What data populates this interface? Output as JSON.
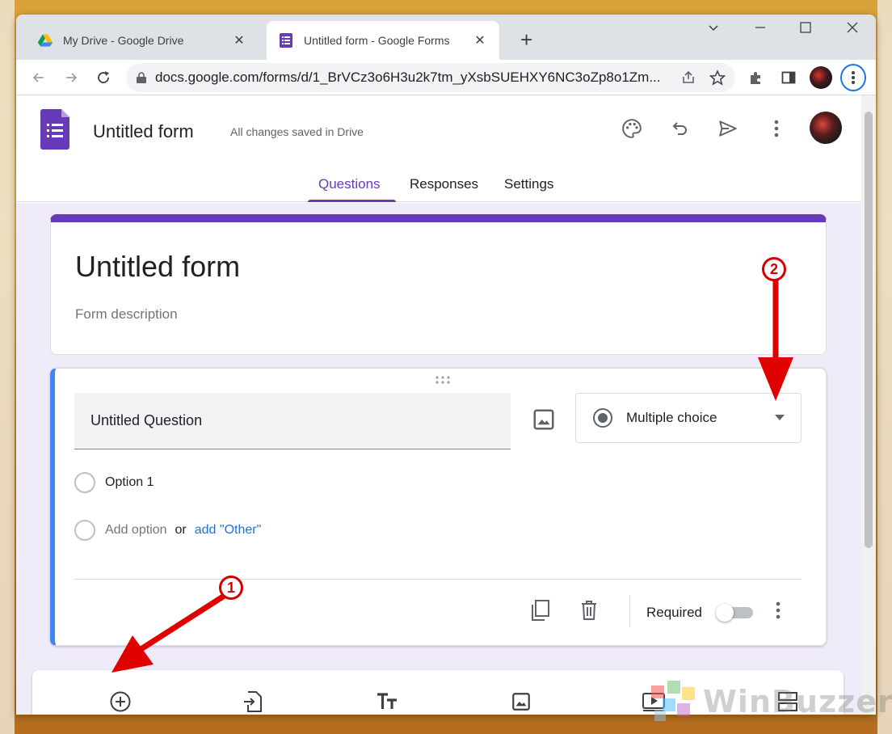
{
  "browser": {
    "tabs": [
      {
        "title": "My Drive - Google Drive",
        "active": false,
        "favicon": "google-drive-icon"
      },
      {
        "title": "Untitled form - Google Forms",
        "active": true,
        "favicon": "google-forms-icon"
      }
    ],
    "close_glyph": "✕",
    "new_tab_glyph": "+",
    "url": "docs.google.com/forms/d/1_BrVCz3o6H3u2k7tm_yXsbSUEHXY6NC3oZp8o1Zm..."
  },
  "forms": {
    "form_name": "Untitled form",
    "save_status": "All changes saved in Drive",
    "tabs": {
      "questions": "Questions",
      "responses": "Responses",
      "settings": "Settings"
    },
    "title_card": {
      "title": "Untitled form",
      "description": "Form description"
    },
    "question": {
      "title": "Untitled Question",
      "type": "Multiple choice",
      "options": [
        "Option 1"
      ],
      "add_option": "Add option",
      "or": "or",
      "add_other": "add \"Other\"",
      "required_label": "Required",
      "required": false
    }
  },
  "annotations": {
    "badge1": "1",
    "badge2": "2"
  },
  "watermark": "WinBuzzer",
  "colors": {
    "accent": "#673ab7",
    "question_border": "#4285f4",
    "link": "#1a73e8",
    "annotation": "#d40000"
  }
}
